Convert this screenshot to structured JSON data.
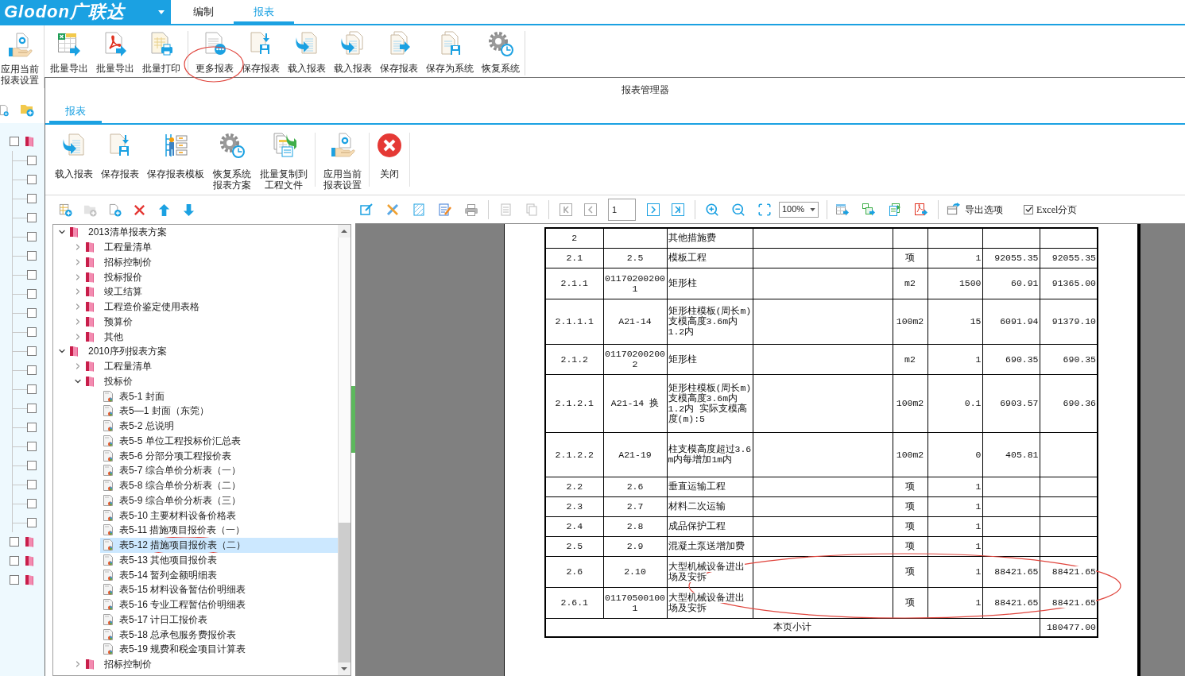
{
  "logo": "Glodon广联达",
  "tabs": [
    {
      "label": "编制",
      "selected": false
    },
    {
      "label": "报表",
      "selected": true
    }
  ],
  "ribbon": {
    "items": [
      {
        "label": "应用当前报表设置"
      },
      {
        "label": "批量导出"
      },
      {
        "label": "批量导出"
      },
      {
        "label": "批量打印"
      },
      {
        "label": "更多报表"
      },
      {
        "label": "保存报表"
      },
      {
        "label": "载入报表"
      },
      {
        "label": "载入报表"
      },
      {
        "label": "保存报表"
      },
      {
        "label": "保存为系统"
      },
      {
        "label": "恢复系统"
      }
    ]
  },
  "background_tree": {
    "rows": [
      {
        "kind": "group",
        "checked": false
      },
      {
        "kind": "item",
        "checked": false
      },
      {
        "kind": "item",
        "checked": false
      },
      {
        "kind": "item",
        "checked": false
      },
      {
        "kind": "item",
        "checked": false
      },
      {
        "kind": "item",
        "checked": false
      },
      {
        "kind": "item",
        "checked": false
      },
      {
        "kind": "item",
        "checked": false
      },
      {
        "kind": "item",
        "checked": false
      },
      {
        "kind": "item",
        "checked": false
      },
      {
        "kind": "item",
        "checked": false
      },
      {
        "kind": "item",
        "checked": false
      },
      {
        "kind": "item",
        "checked": false
      },
      {
        "kind": "item",
        "checked": false
      },
      {
        "kind": "item",
        "checked": false
      },
      {
        "kind": "item",
        "checked": false
      },
      {
        "kind": "item",
        "checked": false
      },
      {
        "kind": "item",
        "checked": false
      },
      {
        "kind": "item",
        "checked": false
      },
      {
        "kind": "item",
        "checked": false
      },
      {
        "kind": "item",
        "checked": false
      },
      {
        "kind": "group",
        "checked": false
      },
      {
        "kind": "group",
        "checked": false
      },
      {
        "kind": "group",
        "checked": false
      }
    ]
  },
  "dialog": {
    "title": "报表管理器",
    "tabs": [
      {
        "label": "报表",
        "selected": true
      }
    ],
    "toolbar": [
      {
        "label": "载入报表"
      },
      {
        "label": "保存报表"
      },
      {
        "label": "保存报表模板"
      },
      {
        "label": "恢复系统报表方案"
      },
      {
        "label": "批量复制到工程文件"
      },
      {
        "label": "应用当前报表设置"
      },
      {
        "label": "关闭"
      }
    ],
    "tree_toolbar": [
      {
        "disabled": false
      },
      {
        "disabled": true
      },
      {
        "disabled": false
      },
      {
        "disabled": false
      },
      {
        "disabled": false
      },
      {
        "disabled": false
      }
    ],
    "report_tree": [
      {
        "kind": "folder",
        "label": "2013清单报表方案",
        "expanded": true,
        "selected": false,
        "children": [
          {
            "kind": "folder",
            "label": "工程量清单",
            "expanded": false,
            "selected": false
          },
          {
            "kind": "folder",
            "label": "招标控制价",
            "expanded": false,
            "selected": false
          },
          {
            "kind": "folder",
            "label": "投标报价",
            "expanded": false,
            "selected": false
          },
          {
            "kind": "folder",
            "label": "竣工结算",
            "expanded": false,
            "selected": false
          },
          {
            "kind": "folder",
            "label": "工程造价鉴定使用表格",
            "expanded": false,
            "selected": false
          },
          {
            "kind": "folder",
            "label": "预算价",
            "expanded": false,
            "selected": false
          },
          {
            "kind": "folder",
            "label": "其他",
            "expanded": false,
            "selected": false
          }
        ]
      },
      {
        "kind": "folder",
        "label": "2010序列报表方案",
        "expanded": true,
        "selected": false,
        "children": [
          {
            "kind": "folder",
            "label": "工程量清单",
            "expanded": false,
            "selected": false
          },
          {
            "kind": "folder",
            "label": "投标价",
            "expanded": true,
            "selected": false,
            "children": [
              {
                "kind": "report",
                "label": "表5-1 封面",
                "selected": false
              },
              {
                "kind": "report",
                "label": "表5—1 封面（东莞）",
                "selected": false
              },
              {
                "kind": "report",
                "label": "表5-2 总说明",
                "selected": false
              },
              {
                "kind": "report",
                "label": "表5-5 单位工程投标价汇总表",
                "selected": false
              },
              {
                "kind": "report",
                "label": "表5-6 分部分项工程报价表",
                "selected": false
              },
              {
                "kind": "report",
                "label": "表5-7 综合单价分析表（一）",
                "selected": false
              },
              {
                "kind": "report",
                "label": "表5-8 综合单价分析表（二）",
                "selected": false
              },
              {
                "kind": "report",
                "label": "表5-9 综合单价分析表（三）",
                "selected": false
              },
              {
                "kind": "report",
                "label": "表5-10 主要材料设备价格表",
                "selected": false
              },
              {
                "kind": "report",
                "label": "表5-11 措施项目报价表（一）",
                "selected": false
              },
              {
                "kind": "report",
                "label": "表5-12 措施项目报价表（二）",
                "selected": true
              },
              {
                "kind": "report",
                "label": "表5-13 其他项目报价表",
                "selected": false
              },
              {
                "kind": "report",
                "label": "表5-14 暂列金额明细表",
                "selected": false
              },
              {
                "kind": "report",
                "label": "表5-15 材料设备暂估价明细表",
                "selected": false
              },
              {
                "kind": "report",
                "label": "表5-16 专业工程暂估价明细表",
                "selected": false
              },
              {
                "kind": "report",
                "label": "表5-17 计日工报价表",
                "selected": false
              },
              {
                "kind": "report",
                "label": "表5-18 总承包服务费报价表",
                "selected": false
              },
              {
                "kind": "report",
                "label": "表5-19 规费和税金项目计算表",
                "selected": false
              }
            ]
          },
          {
            "kind": "folder",
            "label": "招标控制价",
            "expanded": false,
            "selected": false
          }
        ]
      }
    ],
    "preview_toolbar": {
      "page_tools": [
        {
          "disabled": true
        },
        {
          "disabled": true
        }
      ],
      "navigation": [
        {
          "disabled": true
        },
        {
          "disabled": true
        },
        {
          "disabled": false
        },
        {
          "disabled": false
        }
      ],
      "page_field": {
        "value": "1"
      },
      "zoom": {
        "value": "100%"
      },
      "export_options": {
        "label": "导出选项"
      },
      "excel_paging": {
        "label": "Excel分页",
        "checked": true
      }
    },
    "report_table": {
      "rows": [
        {
          "column_1": "2",
          "column_3": "其他措施费"
        },
        {
          "column_1": "2.1",
          "column_2": "2.5",
          "column_3": "模板工程",
          "column_5": "项",
          "column_6": "1",
          "column_7": "92055.35",
          "column_8": "92055.35"
        },
        {
          "column_1": "2.1.1",
          "column_2": "011702002001",
          "column_3": "矩形柱",
          "column_5": "m2",
          "column_6": "1500",
          "column_7": "60.91",
          "column_8": "91365.00"
        },
        {
          "column_1": "2.1.1.1",
          "column_2": "A21-14",
          "column_3": "矩形柱模板(周长m) 支模高度3.6m内 1.2内",
          "column_5": "100m2",
          "column_6": "15",
          "column_7": "6091.94",
          "column_8": "91379.10"
        },
        {
          "column_1": "2.1.2",
          "column_2": "011702002002",
          "column_3": "矩形柱",
          "column_5": "m2",
          "column_6": "1",
          "column_7": "690.35",
          "column_8": "690.35"
        },
        {
          "column_1": "2.1.2.1",
          "column_2": "A21-14 换",
          "column_3": "矩形柱模板(周长m) 支模高度3.6m内 1.2内 实际支模高度(m):5",
          "column_5": "100m2",
          "column_6": "0.1",
          "column_7": "6903.57",
          "column_8": "690.36"
        },
        {
          "column_1": "2.1.2.2",
          "column_2": "A21-19",
          "column_3": "柱支模高度超过3.6m内每增加1m内",
          "column_5": "100m2",
          "column_6": "0",
          "column_7": "405.81"
        },
        {
          "column_1": "2.2",
          "column_2": "2.6",
          "column_3": "垂直运输工程",
          "column_5": "项",
          "column_6": "1"
        },
        {
          "column_1": "2.3",
          "column_2": "2.7",
          "column_3": "材料二次运输",
          "column_5": "项",
          "column_6": "1"
        },
        {
          "column_1": "2.4",
          "column_2": "2.8",
          "column_3": "成品保护工程",
          "column_5": "项",
          "column_6": "1"
        },
        {
          "column_1": "2.5",
          "column_2": "2.9",
          "column_3": "混凝土泵送增加费",
          "column_5": "项",
          "column_6": "1"
        },
        {
          "column_1": "2.6",
          "column_2": "2.10",
          "column_3": "大型机械设备进出场及安拆",
          "column_5": "项",
          "column_6": "1",
          "column_7": "88421.65",
          "column_8": "88421.65"
        },
        {
          "column_1": "2.6.1",
          "column_2": "011705001001",
          "column_3": "大型机械设备进出场及安拆",
          "column_5": "项",
          "column_6": "1",
          "column_7": "88421.65",
          "column_8": "88421.65"
        }
      ],
      "subtotal": {
        "label": "本页小计",
        "value": "180477.00"
      }
    }
  }
}
